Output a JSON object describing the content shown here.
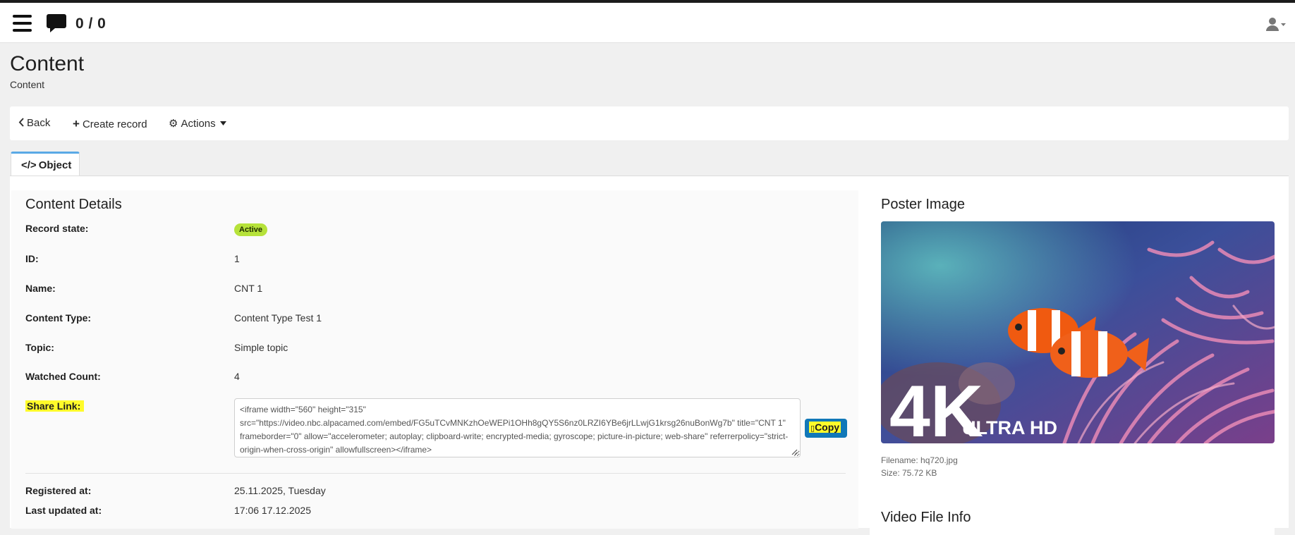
{
  "header": {
    "counter": "0 / 0",
    "icons": [
      "hamburger-icon",
      "chat-icon",
      "user-icon"
    ]
  },
  "page": {
    "title": "Content",
    "subtitle": "Content"
  },
  "toolbar": {
    "back_label": "Back",
    "create_label": "Create record",
    "actions_label": "Actions"
  },
  "tabs": [
    {
      "label": "Object"
    }
  ],
  "details": {
    "title": "Content Details",
    "rows": {
      "record_state": {
        "label": "Record state:",
        "value": "Active"
      },
      "id": {
        "label": "ID:",
        "value": "1"
      },
      "name": {
        "label": "Name:",
        "value": "CNT 1"
      },
      "content_type": {
        "label": "Content Type:",
        "value": "Content Type Test 1"
      },
      "topic": {
        "label": "Topic:",
        "value": "Simple topic"
      },
      "watched_count": {
        "label": "Watched Count:",
        "value": "4"
      },
      "share_link": {
        "label": "Share Link:",
        "value": "<iframe width=\"560\" height=\"315\" src=\"https://video.nbc.alpacamed.com/embed/FG5uTCvMNKzhOeWEPi1OHh8gQY5S6nz0LRZI6YBe6jrLLwjG1krsg26nuBonWg7b\" title=\"CNT 1\" frameborder=\"0\" allow=\"accelerometer; autoplay; clipboard-write; encrypted-media; gyroscope; picture-in-picture; web-share\" referrerpolicy=\"strict-origin-when-cross-origin\" allowfullscreen></iframe>",
        "copy_label": "Copy"
      },
      "registered_at": {
        "label": "Registered at:",
        "value": "25.11.2025, Tuesday"
      },
      "last_updated_at": {
        "label": "Last updated at:",
        "value": "17:06 17.12.2025"
      }
    }
  },
  "poster": {
    "title": "Poster Image",
    "image_overlay": {
      "big": "4K",
      "small": "ULTRA HD"
    },
    "filename": "Filename: hq720.jpg",
    "size": "Size: 75.72 KB"
  },
  "video_info": {
    "title": "Video File Info"
  },
  "colors": {
    "badge_active": "#b6e23a",
    "highlight": "#fffb2a",
    "copy_button": "#1178b8",
    "tab_accent": "#5aa9e6"
  }
}
